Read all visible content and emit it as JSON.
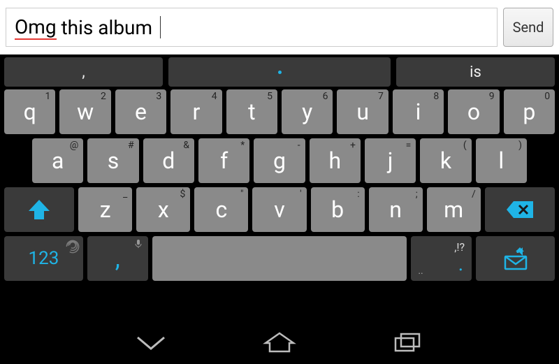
{
  "input_bar": {
    "text_parts": {
      "w1": "Omg",
      "sep1": " ",
      "rest": "this album "
    },
    "send_label": "Send"
  },
  "suggestions": {
    "left": ",",
    "middle": "",
    "right": "is"
  },
  "rows": {
    "r1": [
      {
        "main": "q",
        "sub": "1"
      },
      {
        "main": "w",
        "sub": "2"
      },
      {
        "main": "e",
        "sub": "3"
      },
      {
        "main": "r",
        "sub": "4"
      },
      {
        "main": "t",
        "sub": "5"
      },
      {
        "main": "y",
        "sub": "6"
      },
      {
        "main": "u",
        "sub": "7"
      },
      {
        "main": "i",
        "sub": "8"
      },
      {
        "main": "o",
        "sub": "9"
      },
      {
        "main": "p",
        "sub": "0"
      }
    ],
    "r2": [
      {
        "main": "a",
        "sub": "@"
      },
      {
        "main": "s",
        "sub": "#"
      },
      {
        "main": "d",
        "sub": "&"
      },
      {
        "main": "f",
        "sub": "*"
      },
      {
        "main": "g",
        "sub": "-"
      },
      {
        "main": "h",
        "sub": "+"
      },
      {
        "main": "j",
        "sub": "="
      },
      {
        "main": "k",
        "sub": "("
      },
      {
        "main": "l",
        "sub": ")"
      }
    ],
    "r3": [
      {
        "main": "z",
        "sub": "_"
      },
      {
        "main": "x",
        "sub": "$"
      },
      {
        "main": "c",
        "sub": "\""
      },
      {
        "main": "v",
        "sub": "'"
      },
      {
        "main": "b",
        "sub": ":"
      },
      {
        "main": "n",
        "sub": ";"
      },
      {
        "main": "m",
        "sub": "/"
      }
    ]
  },
  "special": {
    "num_label": "123",
    "comma_label": ",",
    "period_main": ".",
    "period_sub": ",!?",
    "period_sub2": ".."
  },
  "colors": {
    "accent": "#1fb4e6"
  }
}
